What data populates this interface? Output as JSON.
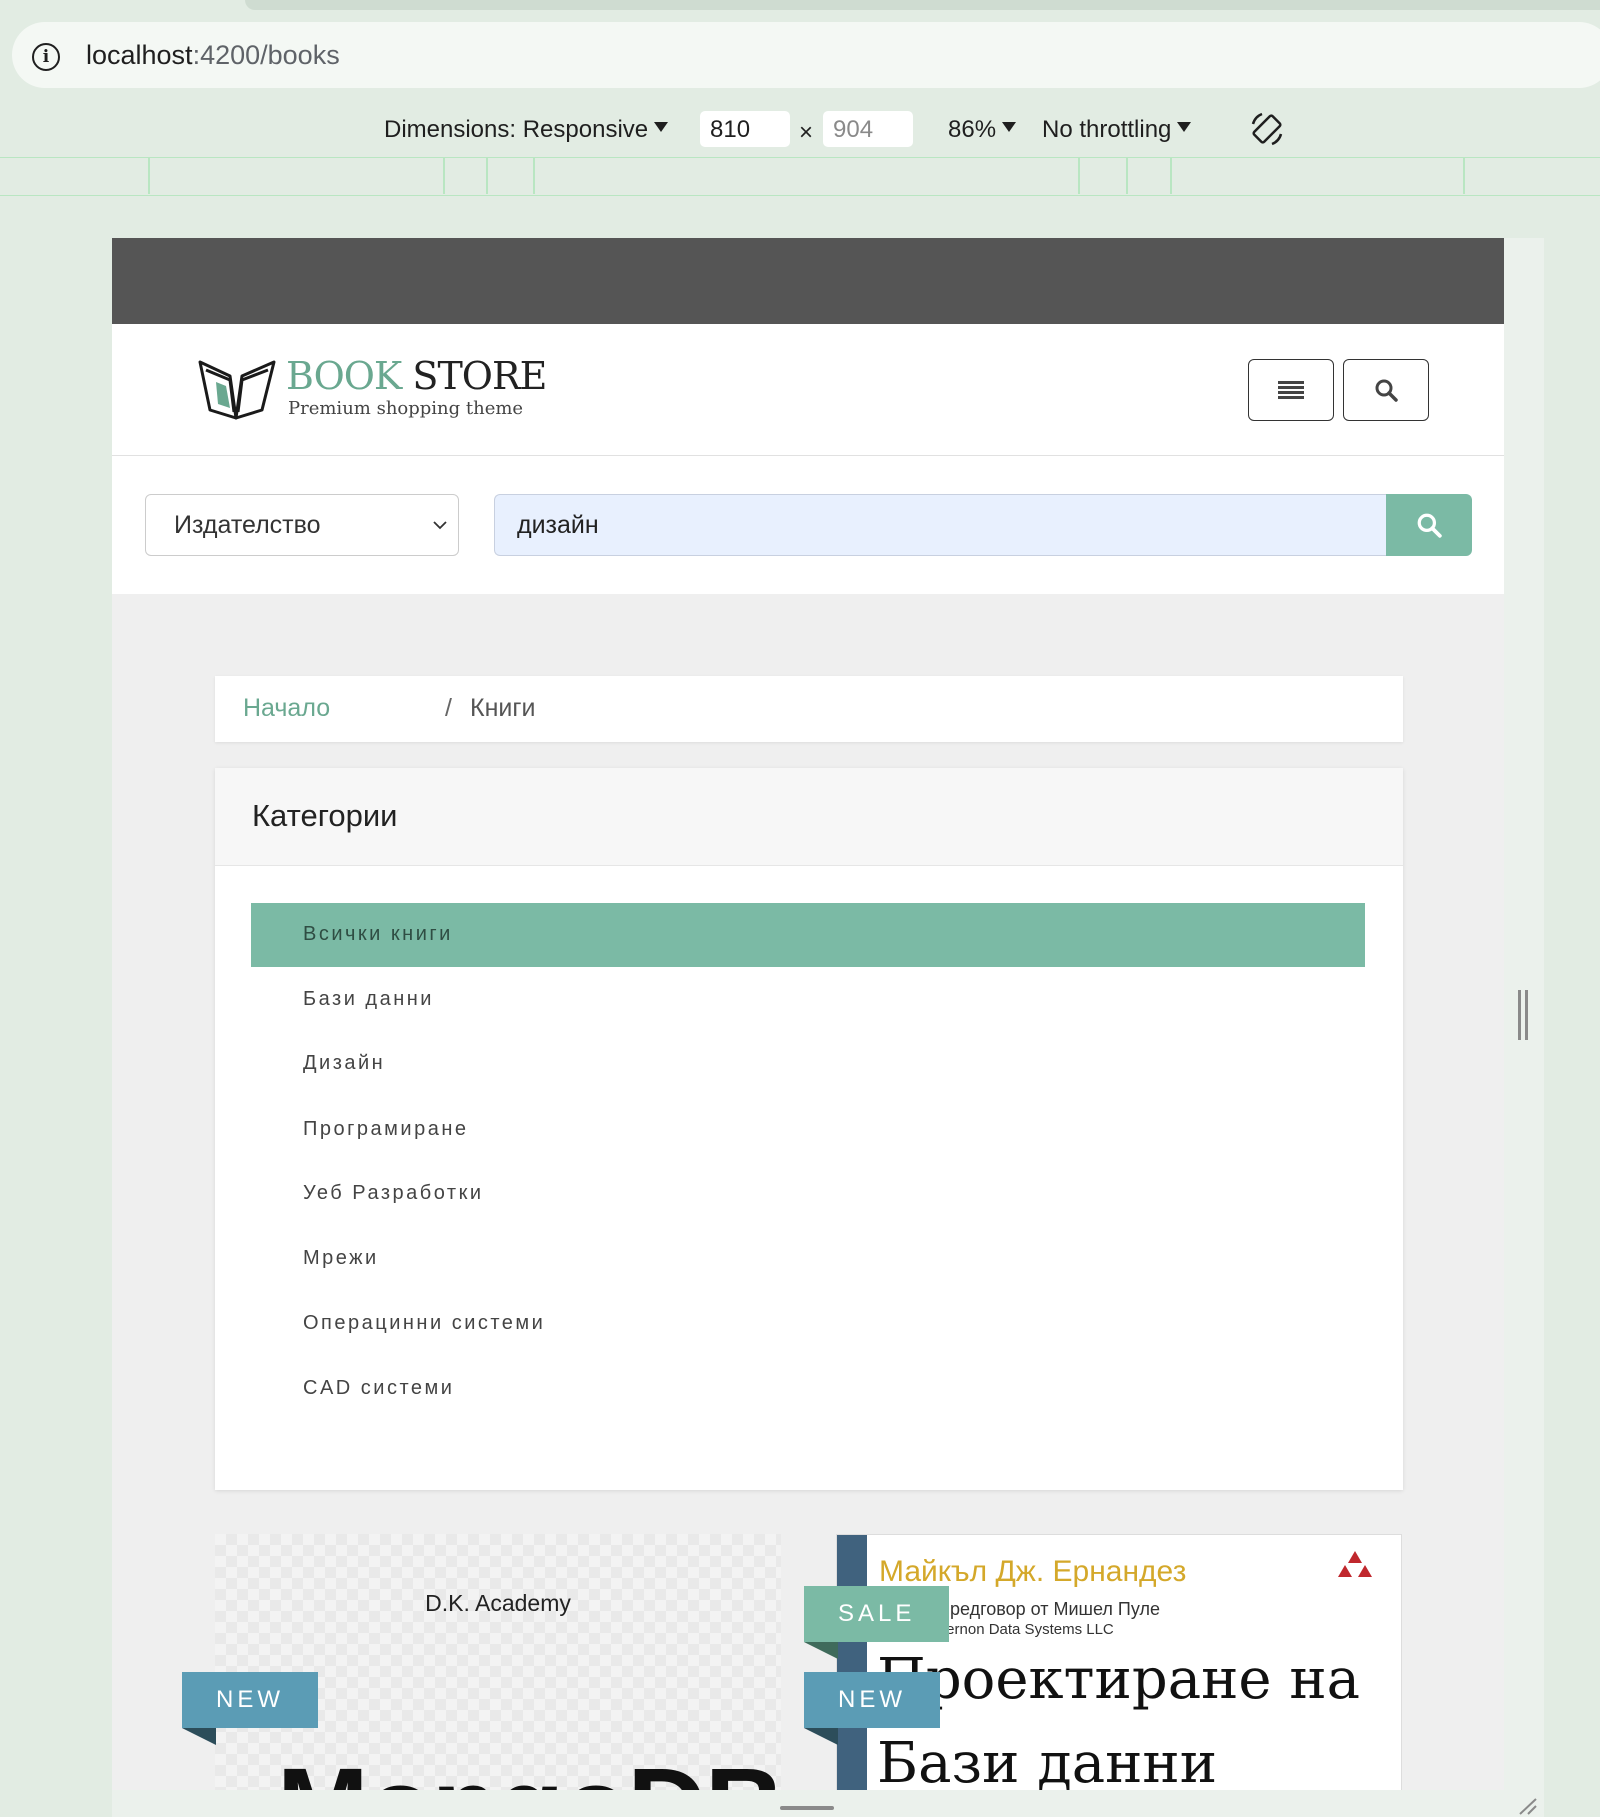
{
  "browser": {
    "url_host": "localhost",
    "url_path": ":4200/books",
    "info_icon": "info-icon"
  },
  "devtools": {
    "dimensions_label": "Dimensions: Responsive",
    "width": "810",
    "times": "×",
    "height": "904",
    "zoom": "86%",
    "throttling": "No throttling",
    "rotate_icon": "rotate-icon"
  },
  "site": {
    "logo": {
      "brand_part1": "BOOK",
      "brand_part2": "STORE",
      "tagline": "Premium shopping theme"
    },
    "header": {
      "menu_icon": "menu-icon",
      "search_icon": "search-icon"
    },
    "search": {
      "filter_selected": "Издателство",
      "query": "дизайн",
      "button_icon": "search-icon"
    },
    "breadcrumb": {
      "home": "Начало",
      "separator": "/",
      "current": "Книги"
    },
    "categories": {
      "title": "Категории",
      "items": [
        {
          "label": "Всички книги",
          "active": true
        },
        {
          "label": "Бази данни",
          "active": false
        },
        {
          "label": "Дизайн",
          "active": false
        },
        {
          "label": "Програмиране",
          "active": false
        },
        {
          "label": "Уеб Разработки",
          "active": false
        },
        {
          "label": "Мрежи",
          "active": false
        },
        {
          "label": "Операцинни системи",
          "active": false
        },
        {
          "label": "CAD системи",
          "active": false
        }
      ]
    },
    "products": [
      {
        "cover_publisher": "D.K. Academy",
        "cover_title": "MongoDB",
        "badges": [
          "NEW"
        ]
      },
      {
        "cover_author": "Майкъл Дж. Ернандез",
        "cover_line2": "Предговор от Мишел Пуле",
        "cover_line3": "Vernon Data Systems LLC",
        "cover_title_line1": "Проектиране на",
        "cover_title_line2": "Бази данни",
        "badges": [
          "SALE",
          "NEW"
        ]
      }
    ]
  },
  "colors": {
    "accent": "#7bbaa5",
    "badge_new": "#5b9cb5",
    "topbar": "#555555"
  }
}
